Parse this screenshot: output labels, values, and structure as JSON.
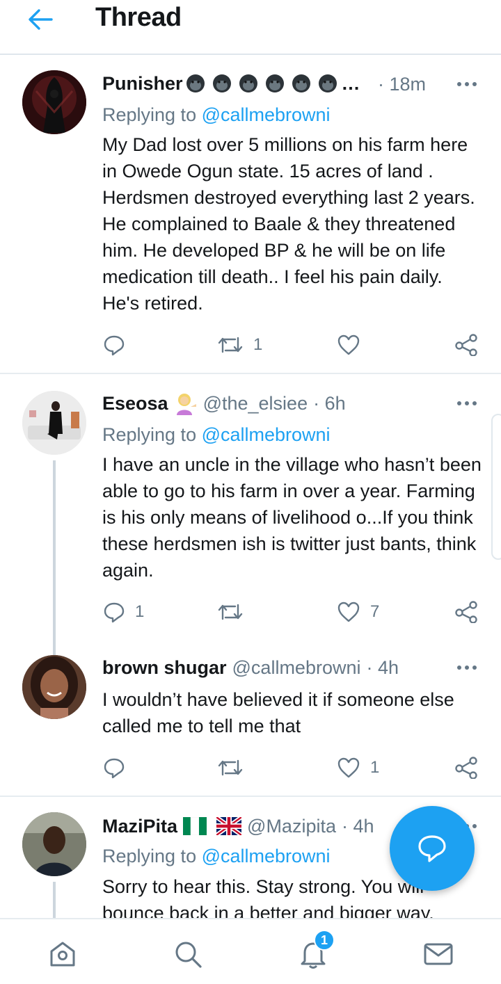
{
  "header": {
    "title": "Thread",
    "back_icon": "arrow-left-icon"
  },
  "tweets": [
    {
      "name": "Punisher",
      "name_suffix": "…",
      "time": "· 18m",
      "replying_prefix": "Replying to ",
      "replying_to": "@callmebrowni",
      "text": "My Dad lost over 5 millions on his farm here in Owede Ogun state. 15 acres of land . Herdsmen destroyed everything last 2 years. He complained to Baale & they threatened him. He developed BP & he will be on life medication till death.. I feel his pain daily. He's retired.",
      "replies": "",
      "retweets": "1",
      "likes": ""
    },
    {
      "name": "Eseosa",
      "handle": "@the_elsiee",
      "time": "· 6h",
      "replying_prefix": "Replying to ",
      "replying_to": "@callmebrowni",
      "text": "I have an uncle in the village who hasn’t been able to go to his farm in over a year. Farming is his only means of livelihood o...If you think these herdsmen  ish is twitter just bants, think again.",
      "replies": "1",
      "retweets": "",
      "likes": "7"
    },
    {
      "name": "brown shugar",
      "handle": "@callmebrowni",
      "time": "· 4h",
      "text": "I wouldn’t have believed it if someone else called me to tell me that",
      "replies": "",
      "retweets": "",
      "likes": "1"
    },
    {
      "name": "MaziPita",
      "handle": "@Mazipita",
      "time": "· 4h",
      "replying_prefix": "Replying to ",
      "replying_to": "@callmebrowni",
      "text": "Sorry to hear this. Stay strong. You will bounce back in a better and bigger way."
    }
  ],
  "nav": {
    "items": [
      "home-icon",
      "search-icon",
      "notifications-icon",
      "messages-icon"
    ],
    "notification_badge": "1"
  },
  "colors": {
    "accent": "#1da1f2",
    "muted": "#657786",
    "text": "#14171a"
  }
}
